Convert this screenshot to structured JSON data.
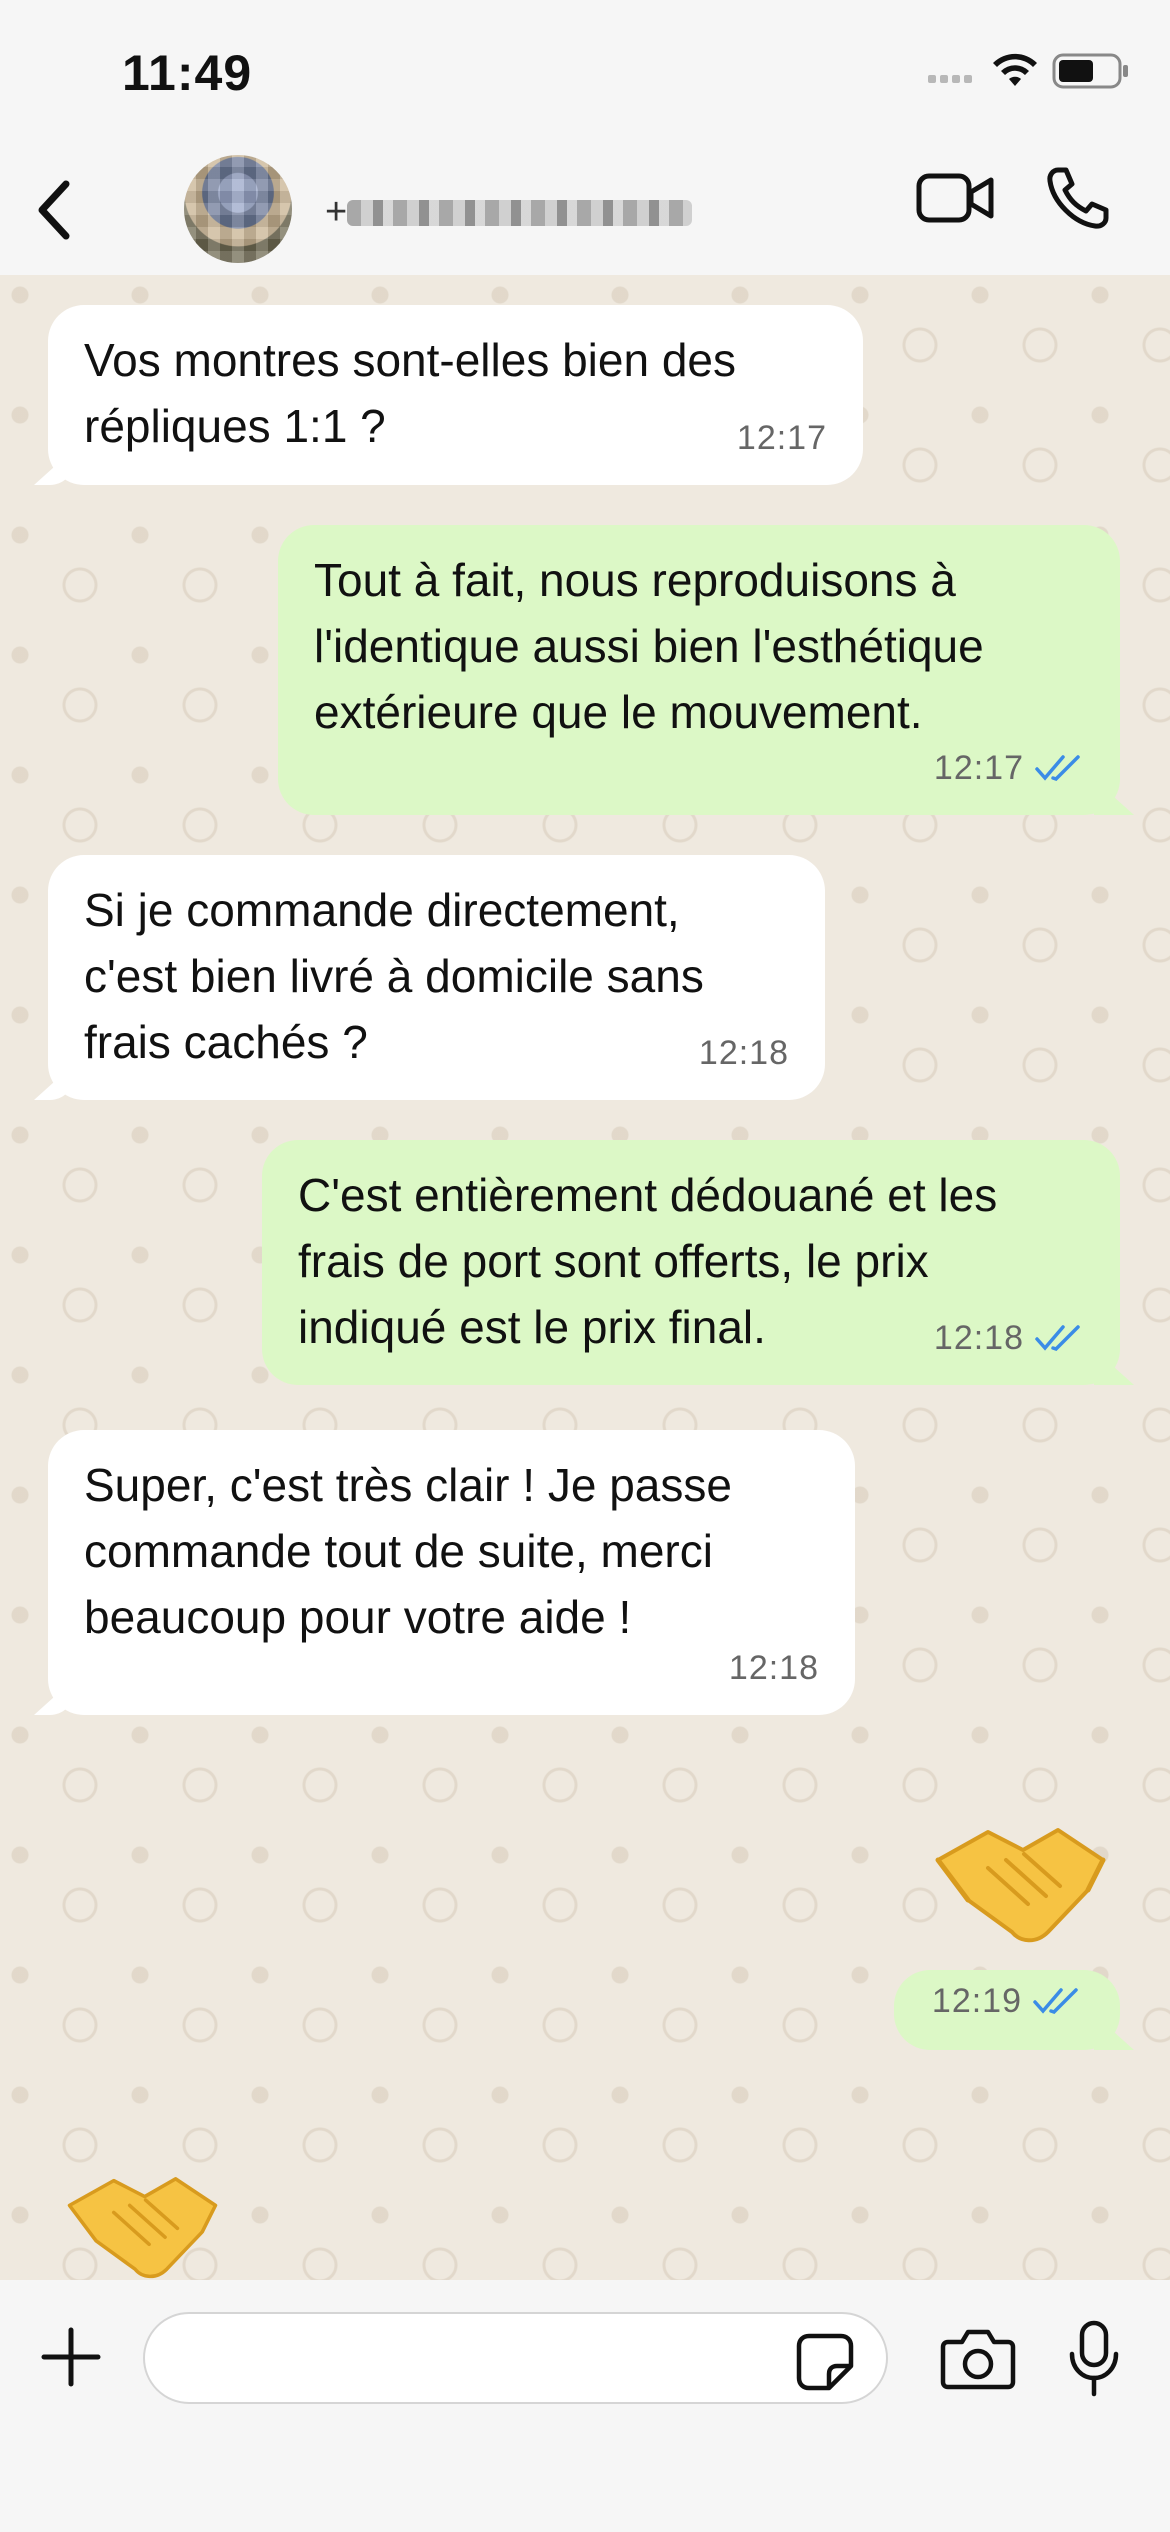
{
  "status_bar": {
    "time": "11:49",
    "icons": [
      "cellular-signal-icon",
      "wifi-icon",
      "battery-icon"
    ]
  },
  "header": {
    "back_icon": "chevron-left-icon",
    "contact_name_prefix": "+",
    "contact_name_blurred": true,
    "actions": [
      "video-call-icon",
      "phone-call-icon"
    ]
  },
  "messages": [
    {
      "direction": "incoming",
      "text": "Vos montres sont-elles bien des\nrépliques 1:1 ?",
      "time": "12:17"
    },
    {
      "direction": "outgoing",
      "text": "Tout à fait, nous reproduisons à\nl'identique aussi bien l'esthétique\nextérieure que le mouvement.",
      "time": "12:17",
      "status": "read"
    },
    {
      "direction": "incoming",
      "text": "Si je commande directement,\nc'est bien livré à domicile sans\nfrais cachés ?",
      "time": "12:18"
    },
    {
      "direction": "outgoing",
      "text": "C'est entièrement dédouané et les\nfrais de port sont offerts, le prix\nindiqué est le prix final.",
      "time": "12:18",
      "status": "read"
    },
    {
      "direction": "incoming",
      "text": "Super, c'est très clair ! Je passe\ncommande tout de suite, merci\nbeaucoup pour votre aide !",
      "time": "12:18"
    },
    {
      "direction": "outgoing",
      "emoji": "handshake",
      "time": "12:19",
      "status": "read"
    },
    {
      "direction": "incoming",
      "emoji": "handshake"
    }
  ],
  "input_bar": {
    "plus_icon": "plus-icon",
    "message_value": "",
    "sticker_icon": "sticker-icon",
    "camera_icon": "camera-icon",
    "mic_icon": "microphone-icon"
  },
  "colors": {
    "incoming_bubble": "#ffffff",
    "outgoing_bubble": "#dcf8c6",
    "read_ticks": "#3b8ce6",
    "chat_background": "#efe9df",
    "bar_background": "#f6f6f6"
  }
}
